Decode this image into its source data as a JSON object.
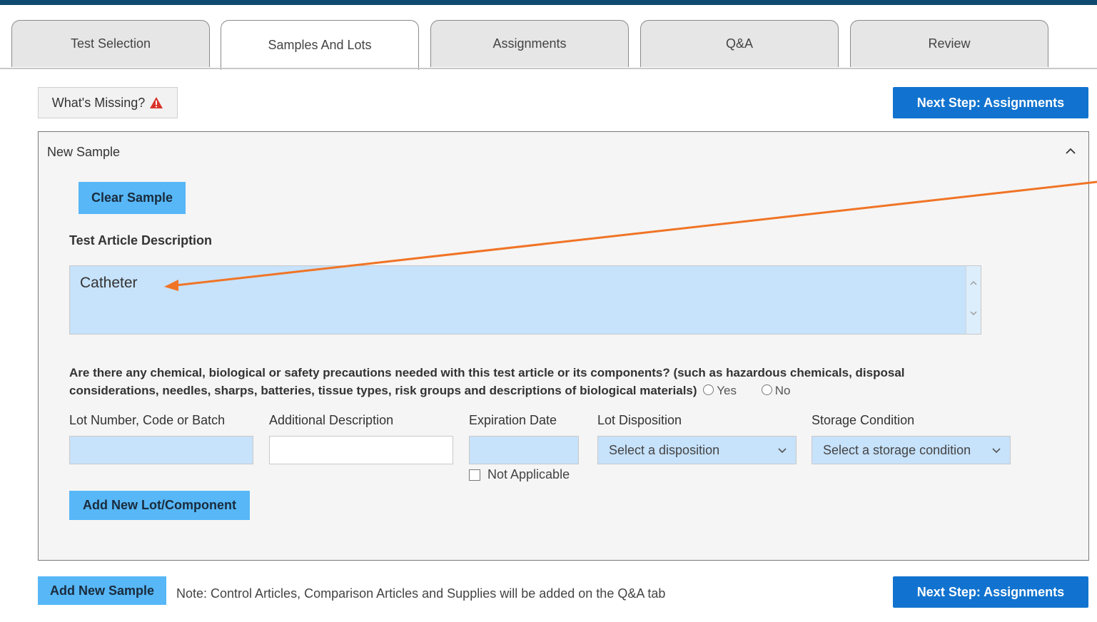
{
  "tabs": [
    {
      "label": "Test Selection",
      "active": false
    },
    {
      "label": "Samples And Lots",
      "active": true
    },
    {
      "label": "Assignments",
      "active": false
    },
    {
      "label": "Q&A",
      "active": false
    },
    {
      "label": "Review",
      "active": false
    }
  ],
  "toolbar": {
    "whats_missing_label": "What's Missing?",
    "warning_icon": "warning-triangle-icon",
    "next_step_label": "Next Step: Assignments"
  },
  "sample": {
    "title": "New Sample",
    "clear_label": "Clear Sample",
    "description_label": "Test Article Description",
    "description_value": "Catheter",
    "precautions_question": "Are there any chemical, biological or safety precautions needed with this test article or its components? (such as hazardous chemicals, disposal considerations, needles, sharps, batteries, tissue types, risk groups and descriptions of biological materials)",
    "yes_label": "Yes",
    "no_label": "No",
    "lot": {
      "lot_number_label": "Lot Number, Code or Batch",
      "lot_number_value": "",
      "additional_label": "Additional Description",
      "additional_value": "",
      "expiration_label": "Expiration Date",
      "expiration_value": "",
      "not_applicable_label": "Not Applicable",
      "disposition_label": "Lot Disposition",
      "disposition_selected": "Select a disposition",
      "storage_label": "Storage Condition",
      "storage_selected": "Select a storage condition"
    },
    "add_lot_label": "Add New Lot/Component"
  },
  "footer": {
    "add_sample_label": "Add New Sample",
    "note": "Note: Control Articles, Comparison Articles and Supplies will be added on the Q&A tab",
    "next_step_label": "Next Step: Assignments"
  },
  "colors": {
    "top_bar": "#0f4a70",
    "primary": "#1173cf",
    "light_button": "#57b7f7",
    "input_fill": "#c7e2fb",
    "annotation_arrow": "#f07426",
    "warning": "#d9342b"
  }
}
